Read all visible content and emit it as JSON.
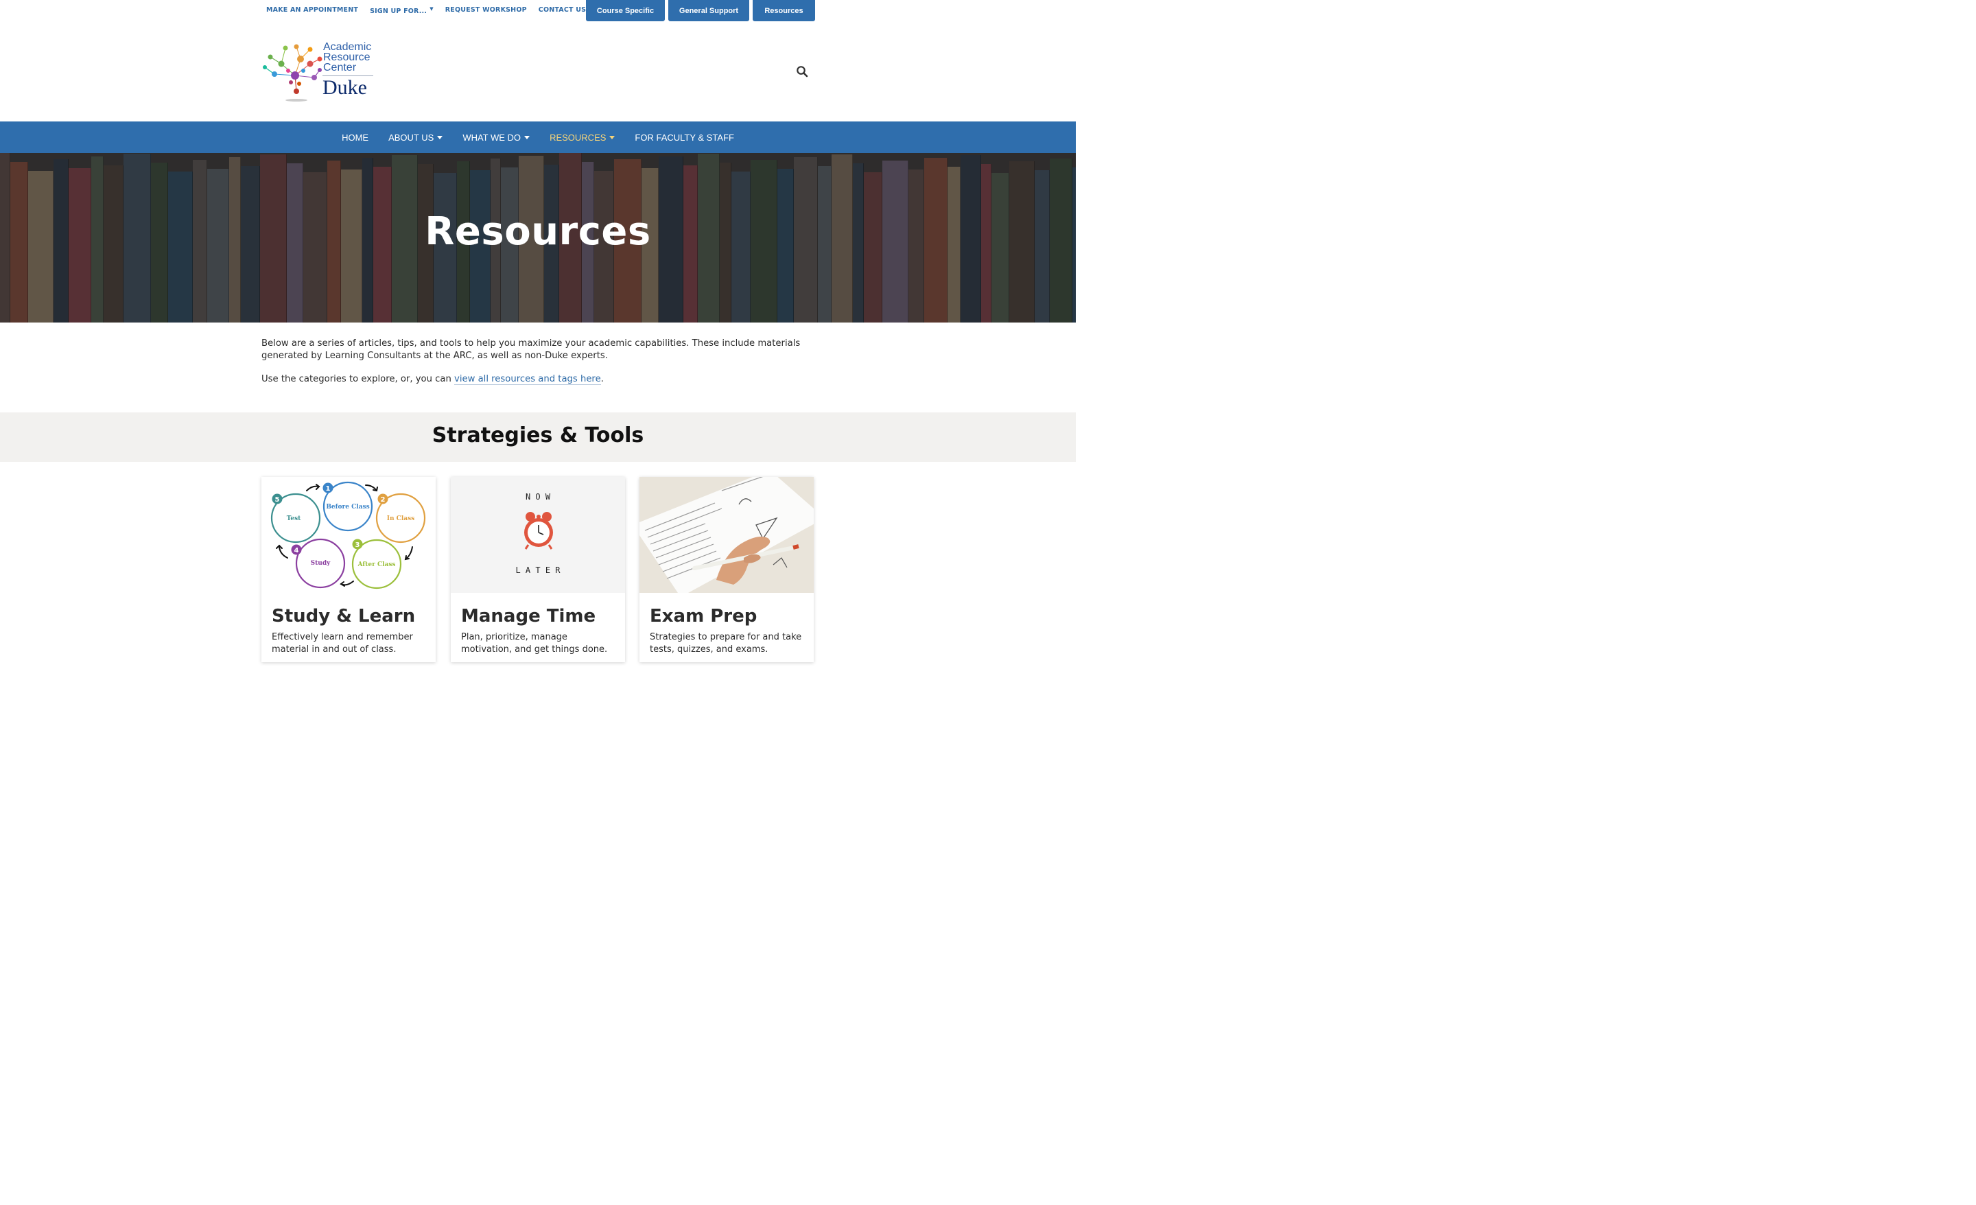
{
  "utility": {
    "links": [
      {
        "label": "MAKE AN APPOINTMENT"
      },
      {
        "label": "SIGN UP FOR..."
      },
      {
        "label": "REQUEST WORKSHOP"
      },
      {
        "label": "CONTACT US"
      }
    ],
    "buttons": [
      {
        "label": "Course Specific"
      },
      {
        "label": "General Support"
      },
      {
        "label": "Resources"
      }
    ]
  },
  "logo": {
    "line1": "Academic",
    "line2": "Resource",
    "line3": "Center",
    "brand": "Duke"
  },
  "nav": {
    "items": [
      {
        "label": "HOME"
      },
      {
        "label": "ABOUT US"
      },
      {
        "label": "WHAT WE DO"
      },
      {
        "label": "RESOURCES"
      },
      {
        "label": "FOR FACULTY & STAFF"
      }
    ]
  },
  "hero": {
    "title": "Resources"
  },
  "intro": {
    "p1": "Below are a series of articles, tips, and tools to help you maximize your academic capabilities. These include materials generated by Learning Consultants at the ARC, as well as non-Duke experts.",
    "p2_prefix": "Use the categories to explore, or, you can ",
    "p2_link": "view all resources and tags here",
    "p2_suffix": "."
  },
  "section": {
    "title": "Strategies & Tools"
  },
  "cards": [
    {
      "title": "Study & Learn",
      "desc": "Effectively learn and remember material in and out of class.",
      "cycle": {
        "steps": [
          {
            "num": "1",
            "label": "Before Class"
          },
          {
            "num": "2",
            "label": "In Class"
          },
          {
            "num": "3",
            "label": "After Class"
          },
          {
            "num": "4",
            "label": "Study"
          },
          {
            "num": "5",
            "label": "Test"
          }
        ]
      }
    },
    {
      "title": "Manage Time",
      "desc": "Plan, prioritize, manage motivation, and get things done.",
      "img_top": "N O W",
      "img_bottom": "L A T E R"
    },
    {
      "title": "Exam Prep",
      "desc": "Strategies to prepare for and take tests, quizzes, and exams."
    }
  ],
  "colors": {
    "primary": "#2f6ead",
    "nav_active": "#f7d57a",
    "link": "#2d6aa7",
    "band": "#f2f1ef",
    "step1": "#3a84c9",
    "step2": "#e0a040",
    "step3": "#9bbf3b",
    "step4": "#8b3fa0",
    "step5": "#3b8f8f"
  }
}
